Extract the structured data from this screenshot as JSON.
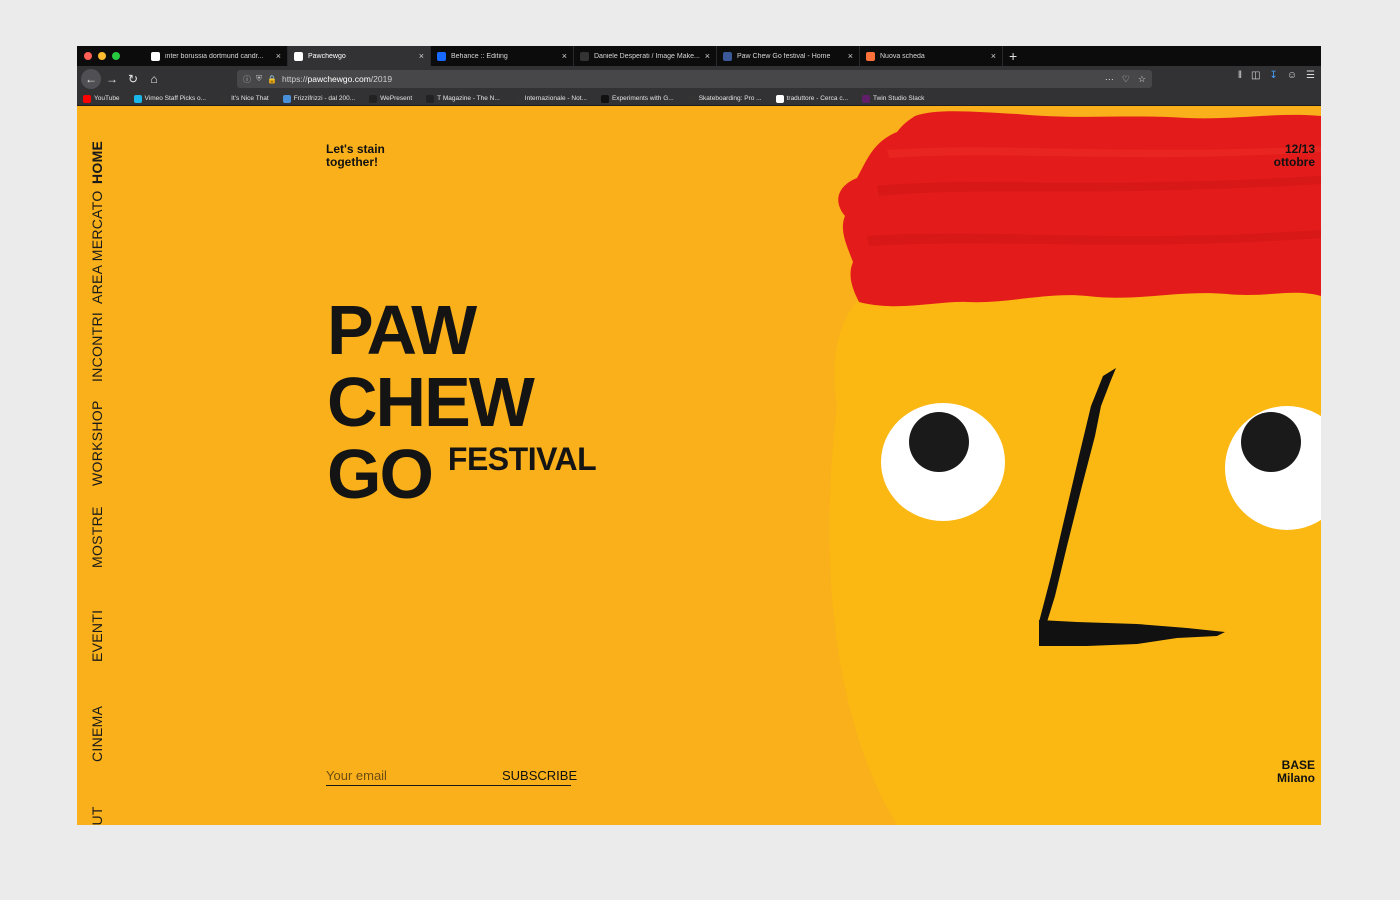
{
  "browser": {
    "tabs": [
      {
        "title": "inter borussia dortmund candr...",
        "favicon": "google-icon",
        "color": "#ffffff",
        "active": false
      },
      {
        "title": "Pawchewgo",
        "favicon": "pawchewgo-icon",
        "color": "#ffffff",
        "active": true
      },
      {
        "title": "Behance :: Editing",
        "favicon": "behance-icon",
        "color": "#1769ff",
        "active": false
      },
      {
        "title": "Daniele Desperati / Image Make...",
        "favicon": "blank-icon",
        "color": "#333333",
        "active": false
      },
      {
        "title": "Paw Chew Go festival - Home",
        "favicon": "facebook-icon",
        "color": "#3b5998",
        "active": false
      },
      {
        "title": "Nuova scheda",
        "favicon": "firefox-icon",
        "color": "#ff7139",
        "active": false
      }
    ],
    "url_prefix": "https://",
    "url_host": "pawchewgo.com",
    "url_path": "/2019",
    "bookmarks": [
      {
        "label": "YouTube",
        "icon": "youtube-icon",
        "color": "#ff0000"
      },
      {
        "label": "Vimeo Staff Picks o...",
        "icon": "vimeo-icon",
        "color": "#1ab7ea"
      },
      {
        "label": "It's Nice That",
        "icon": "itsnicethat-icon",
        "color": "#333333"
      },
      {
        "label": "Frizzifrizzi - dal 200...",
        "icon": "frizzifrizzi-icon",
        "color": "#4a90d9"
      },
      {
        "label": "WePresent",
        "icon": "wepresent-icon",
        "color": "#222222"
      },
      {
        "label": "T Magazine - The N...",
        "icon": "nyt-icon",
        "color": "#222222"
      },
      {
        "label": "Internazionale - Not...",
        "icon": "internazionale-icon",
        "color": "#333333"
      },
      {
        "label": "Experiments with G...",
        "icon": "experiments-icon",
        "color": "#111111"
      },
      {
        "label": "Skateboarding: Pro ...",
        "icon": "skate-icon",
        "color": "#333333"
      },
      {
        "label": "traduttore - Cerca c...",
        "icon": "google-icon",
        "color": "#ffffff"
      },
      {
        "label": "Twin Studio Slack",
        "icon": "slack-icon",
        "color": "#611f69"
      }
    ]
  },
  "page": {
    "nav": [
      "HOME",
      "AREA MERCATO",
      "INCONTRI",
      "WORKSHOP",
      "MOSTRE",
      "EVENTI",
      "CINEMA",
      "ABOUT"
    ],
    "tagline": [
      "Let's stain",
      "together!"
    ],
    "dates": [
      "12/13",
      "ottobre"
    ],
    "title_lines": [
      "PAW",
      "CHEW",
      "GO"
    ],
    "title_suffix": "FESTIVAL",
    "email_placeholder": "Your email",
    "subscribe_label": "SUBSCRIBE",
    "location": [
      "BASE",
      "Milano"
    ]
  },
  "colors": {
    "background": "#fab01a",
    "accent_red": "#e31b1b",
    "ink": "#141414"
  }
}
